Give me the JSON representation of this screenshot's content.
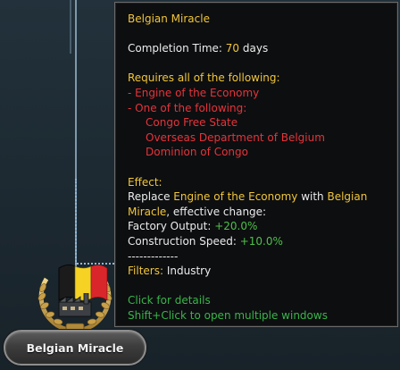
{
  "focus": {
    "name": "Belgian Miracle",
    "plate_label": "Belgian Miracle",
    "icon": "belgian-flag-factory-icon",
    "flag_colors": [
      "#1b1b1b",
      "#f5d223",
      "#d9262b"
    ]
  },
  "tooltip": {
    "title": "Belgian Miracle",
    "completion_label": "Completion Time: ",
    "completion_value": "70",
    "completion_unit": " days",
    "requires_header": "Requires all of the following:",
    "req_1": "- Engine of the Economy",
    "req_2": "- One of the following:",
    "req_2_options": [
      "Congo Free State",
      "Overseas Department of Belgium",
      "Dominion of Congo"
    ],
    "effect_header": "Effect:",
    "effect_replace": "Replace ",
    "effect_old": "Engine of the Economy",
    "effect_with": " with ",
    "effect_new_1": "Belgian",
    "effect_new_2": "Miracle",
    "effect_change": ", effective change:",
    "mod_1_label": " Factory Output: ",
    "mod_1_value": "+20.0%",
    "mod_2_label": " Construction Speed: ",
    "mod_2_value": "+10.0%",
    "separator": "-------------",
    "filters_label": "Filters:",
    "filters_value": " Industry",
    "hint_1": "Click for details",
    "hint_2": "Shift+Click to open multiple windows"
  },
  "colors": {
    "gold": "#f0c63a",
    "red": "#e5343a",
    "green": "#39b54a"
  }
}
